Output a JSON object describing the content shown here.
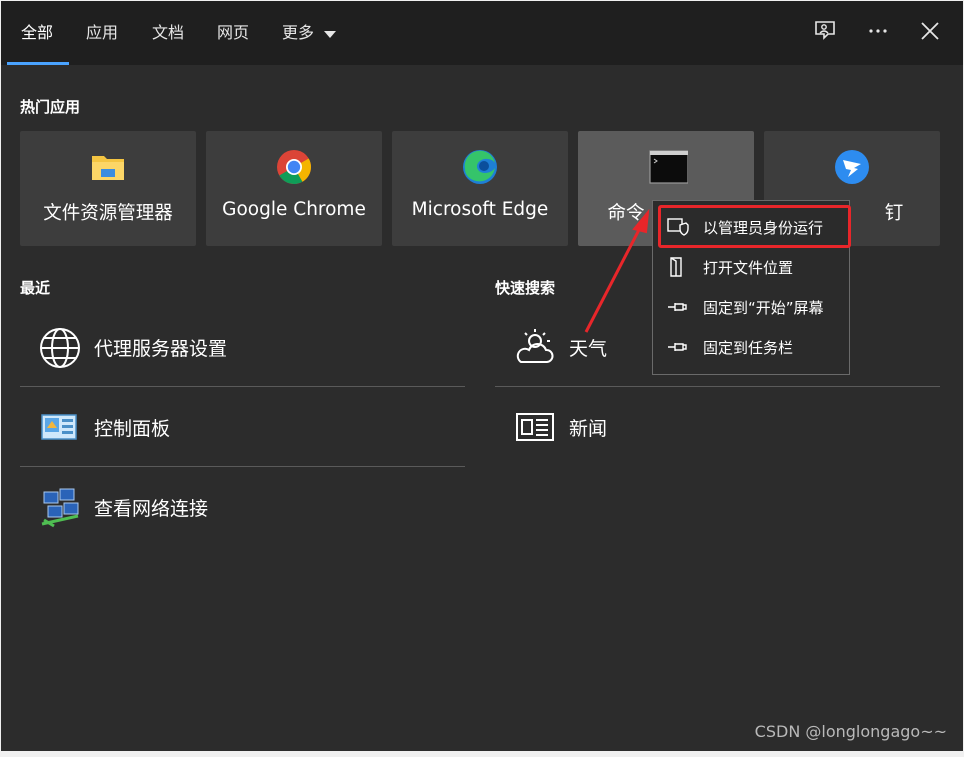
{
  "tabs": [
    "全部",
    "应用",
    "文档",
    "网页",
    "更多"
  ],
  "sections": {
    "hot_apps": "热门应用",
    "recent": "最近",
    "quick_search": "快速搜索"
  },
  "tiles": [
    {
      "label": "文件资源管理器",
      "icon": "folder-icon"
    },
    {
      "label": "Google Chrome",
      "icon": "chrome-icon"
    },
    {
      "label": "Microsoft Edge",
      "icon": "edge-icon"
    },
    {
      "label": "命令",
      "icon": "terminal-icon"
    },
    {
      "label": "钉",
      "icon": "dingtalk-icon"
    }
  ],
  "recent": [
    {
      "label": "代理服务器设置",
      "icon": "globe-icon"
    },
    {
      "label": "控制面板",
      "icon": "control-panel-icon"
    },
    {
      "label": "查看网络连接",
      "icon": "network-icon"
    }
  ],
  "quick": [
    {
      "label": "天气",
      "icon": "weather-icon"
    },
    {
      "label": "新闻",
      "icon": "news-icon"
    }
  ],
  "context_menu": [
    {
      "label": "以管理员身份运行",
      "icon": "shield-icon"
    },
    {
      "label": "打开文件位置",
      "icon": "file-location-icon"
    },
    {
      "label": "固定到“开始”屏幕",
      "icon": "pin-icon"
    },
    {
      "label": "固定到任务栏",
      "icon": "pin-icon"
    }
  ],
  "watermark": "CSDN @longlongago~~",
  "colors": {
    "accent": "#4aa3ff",
    "highlight": "#e8262a",
    "background": "#2c2c2c",
    "tile": "#3d3d3d"
  }
}
